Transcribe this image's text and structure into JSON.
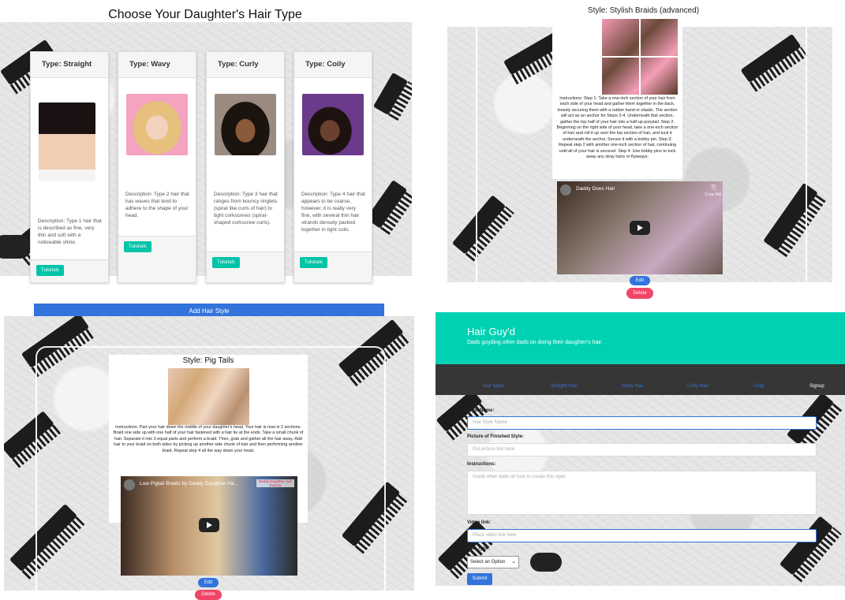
{
  "panel1": {
    "title": "Choose Your Daughter's Hair Type",
    "cards": [
      {
        "type": "Type: Straight",
        "description": "Description: Type 1 hair that is described as fine, very thin and soft with a noticeable shine.",
        "button": "Tutorials"
      },
      {
        "type": "Type: Wavy",
        "description": "Description: Type 2 hair that has waves that tend to adhere to the shape of your head.",
        "button": "Tutorials"
      },
      {
        "type": "Type: Curly",
        "description": "Description: Type 3 hair that ranges from bouncy ringlets (spiral like curls of hair) to tight corkscrews (spiral-shaped corkscrew curls).",
        "button": "Tutorials"
      },
      {
        "type": "Type: Coily",
        "description": "Description: Type 4 hair that appears to be coarse, however, it is really very fine, with several thin hair strands densely packed together in tight coils.",
        "button": "Tutorials"
      }
    ]
  },
  "panel2": {
    "title": "Style: Stylish Braids (advanced)",
    "instructions": "Instructions: Step 1: Take a one-inch section of your hair from each side of your head and gather them together in the back, loosely securing them with a rubber band or elastic. The section will act as an anchor for Steps 2-4. Underneath that section, gather the top half of your hair into a half-up ponytail. Step 2: Beginning on the right side of your head, take a one-inch section of hair and roll it up over the top section of hair, and tuck it underneath the anchor. Secure it with a bobby pin. Step 3: Repeat step 2 with another one-inch section of hair, continuing until all of your hair is secured. Step 4: Use bobby pins to tuck away any stray hairs or flyaways.",
    "video_title": "Daddy Does Hair",
    "video_badge": "Copy link",
    "edit": "Edit",
    "delete": "Delete"
  },
  "panel3": {
    "add_button": "Add Hair Style",
    "title": "Style: Pig Tails",
    "instructions": "Instructions: Part your hair down the middle of your daughter's head. Your hair is now in 2 sections. Braid one side up with one half of your hair fastened with a hair tie at the ends. Take a small chunk of hair. Separate it into 3 equal parts and perform a braid. Then, grab and gather all the hair away. Add hair to your braid on both sides by picking up another side chunk of hair and then performing another braid. Repeat step 4 all the way down your head.",
    "video_title": "Low Pigtail Braids by Daddy Daughter Ha...",
    "video_logo": "Daddy Daughter Hair Factory",
    "edit": "Edit",
    "delete": "Delete"
  },
  "panel4": {
    "brand": "Hair Guy'd",
    "tagline": "Dads guyding other dads on doing their daughter's hair.",
    "nav": [
      "Hair types",
      "Straight Hair",
      "Wavy Hair",
      "Curly Hair",
      "Coily",
      "Signup"
    ],
    "form": {
      "style_name_label": "Style Name:",
      "style_name_placeholder": "Hair Style Name",
      "picture_label": "Picture of Finished Style:",
      "picture_placeholder": "Put picture link here",
      "instructions_label": "Instructions:",
      "instructions_placeholder": "Guide other dads on how to create this style.",
      "video_label": "Video link:",
      "video_placeholder": "Place video link here",
      "hair_type_label": "Hair Type:",
      "select_value": "Select an Option",
      "submit": "Submit"
    }
  },
  "colors": {
    "teal": "#00d1b2",
    "card_button": "#00c4a7",
    "link_blue": "#3273dc",
    "delete_pink": "#f14668",
    "dark_nav": "#363636"
  }
}
